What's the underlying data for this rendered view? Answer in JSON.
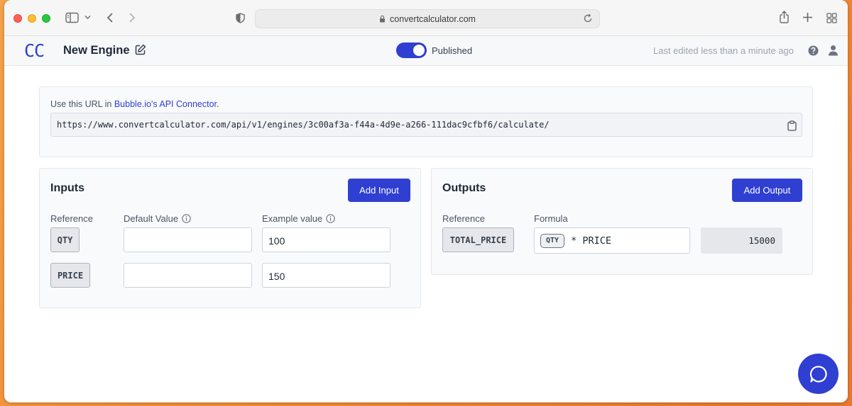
{
  "browser": {
    "url": "convertcalculator.com"
  },
  "header": {
    "logo": "CC",
    "engine_title": "New Engine",
    "published_label": "Published",
    "last_edited": "Last edited less than a minute ago"
  },
  "api": {
    "hint_prefix": "Use this URL in ",
    "hint_link": "Bubble.io's API Connector",
    "hint_suffix": ".",
    "url": "https://www.convertcalculator.com/api/v1/engines/3c00af3a-f44a-4d9e-a266-111dac9cfbf6/calculate/"
  },
  "inputs": {
    "title": "Inputs",
    "add_label": "Add Input",
    "col_reference": "Reference",
    "col_default": "Default Value",
    "col_example": "Example value",
    "rows": [
      {
        "reference": "QTY",
        "default_value": "",
        "example_value": "100"
      },
      {
        "reference": "PRICE",
        "default_value": "",
        "example_value": "150"
      }
    ]
  },
  "outputs": {
    "title": "Outputs",
    "add_label": "Add Output",
    "col_reference": "Reference",
    "col_formula": "Formula",
    "rows": [
      {
        "reference": "TOTAL_PRICE",
        "formula_chip": "QTY",
        "formula_rest": "* PRICE",
        "result": "15000"
      }
    ]
  },
  "colors": {
    "accent": "#2f3fd1",
    "background": "#ef8a35"
  }
}
